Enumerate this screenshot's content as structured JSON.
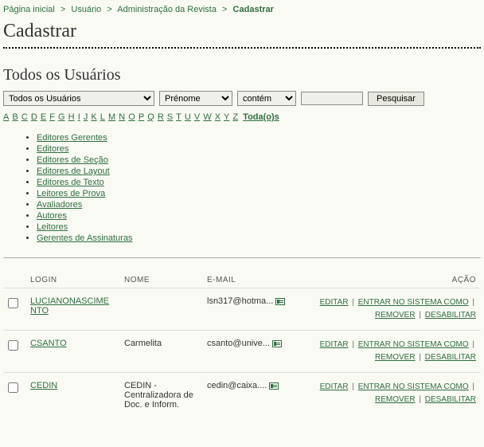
{
  "breadcrumb": {
    "items": [
      {
        "label": "Página inicial"
      },
      {
        "label": "Usuário"
      },
      {
        "label": "Administração da Revista"
      }
    ],
    "current": "Cadastrar"
  },
  "page_title": "Cadastrar",
  "section_title": "Todos os Usuários",
  "search": {
    "role_select": "Todos os Usuários",
    "field_select": "Prénome",
    "match_select": "contém",
    "value": "",
    "button": "Pesquisar"
  },
  "alpha": {
    "letters": [
      "A",
      "B",
      "C",
      "D",
      "E",
      "F",
      "G",
      "H",
      "I",
      "J",
      "K",
      "L",
      "M",
      "N",
      "O",
      "P",
      "Q",
      "R",
      "S",
      "T",
      "U",
      "V",
      "W",
      "X",
      "Y",
      "Z"
    ],
    "all": "Toda(o)s"
  },
  "roles": [
    "Editores Gerentes",
    "Editores",
    "Editores de Seção",
    "Editores de Layout",
    "Editores de Texto",
    "Leitores de Prova",
    "Avaliadores",
    "Autores",
    "Leitores",
    "Gerentes de Assinaturas"
  ],
  "table": {
    "headers": {
      "login": "LOGIN",
      "nome": "NOME",
      "email": "E-MAIL",
      "acao": "AÇÃO"
    },
    "actions": {
      "edit": "EDITAR",
      "login_as": "ENTRAR NO SISTEMA COMO",
      "remove": "REMOVER",
      "disable": "DESABILITAR"
    },
    "rows": [
      {
        "login": "LUCIANONASCIMENTO",
        "nome": "",
        "email": "lsn317@hotma..."
      },
      {
        "login": "CSANTO",
        "nome": "Carmelita",
        "email": "csanto@unive..."
      },
      {
        "login": "CEDIN",
        "nome": "CEDIN - Centralizadora de Doc. e Inform.",
        "email": "cedin@caixa...."
      }
    ]
  }
}
